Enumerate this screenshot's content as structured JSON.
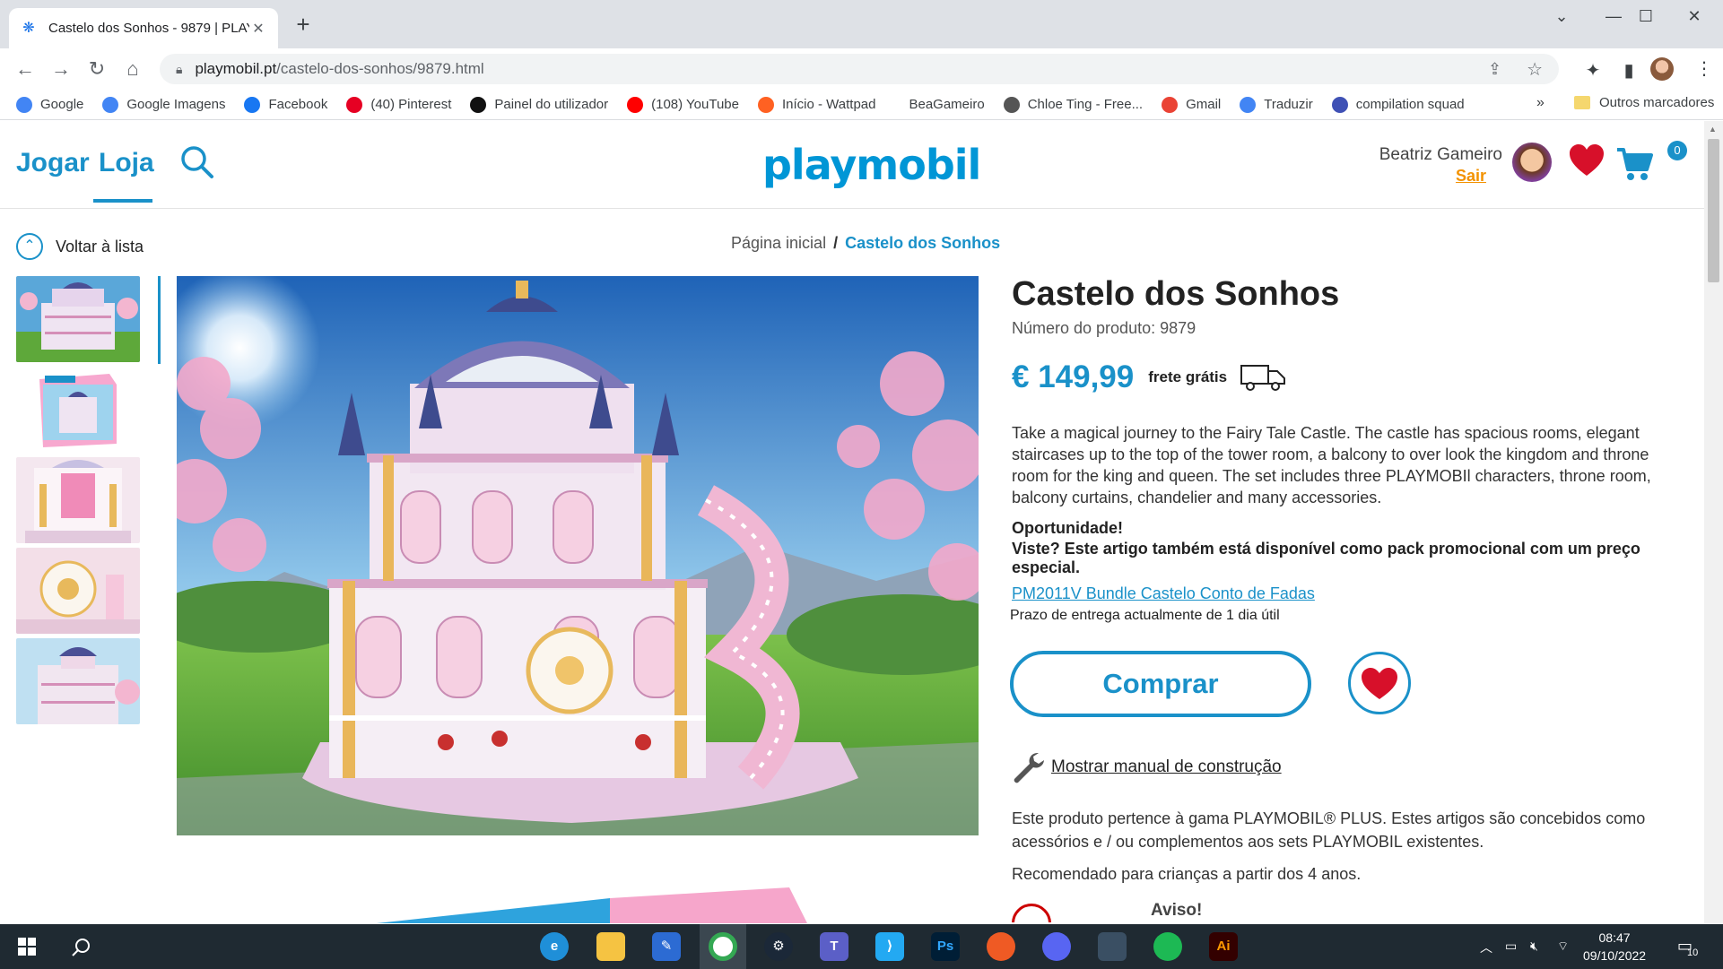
{
  "browser": {
    "tab_title": "Castelo dos Sonhos - 9879 | PLAY",
    "tab_close": "✕",
    "new_tab": "+",
    "url_host": "playmobil.pt",
    "url_path": "/castelo-dos-sonhos/9879.html",
    "window_controls": [
      "⌄",
      "—",
      "☐",
      "✕"
    ],
    "bookmarks": [
      {
        "label": "Google",
        "icon": "google-icon",
        "color": "#4285f4"
      },
      {
        "label": "Google Imagens",
        "icon": "google-icon",
        "color": "#4285f4"
      },
      {
        "label": "Facebook",
        "icon": "facebook-icon",
        "color": "#1877f2"
      },
      {
        "label": "(40) Pinterest",
        "icon": "pinterest-icon",
        "color": "#e60023"
      },
      {
        "label": "Painel do utilizador",
        "icon": "dashboard-icon",
        "color": "#111111"
      },
      {
        "label": "(108) YouTube",
        "icon": "youtube-icon",
        "color": "#ff0000"
      },
      {
        "label": "Início - Wattpad",
        "icon": "wattpad-icon",
        "color": "#ff6122"
      },
      {
        "label": "BeaGameiro",
        "icon": "",
        "color": ""
      },
      {
        "label": "Chloe Ting - Free...",
        "icon": "chloe-icon",
        "color": "#555555"
      },
      {
        "label": "Gmail",
        "icon": "gmail-icon",
        "color": "#ea4335"
      },
      {
        "label": "Traduzir",
        "icon": "translate-icon",
        "color": "#4285f4"
      },
      {
        "label": "compilation squad",
        "icon": "forms-icon",
        "color": "#3f51b5"
      }
    ],
    "bookmarks_more": "»",
    "other_bookmarks": "Outros marcadores"
  },
  "header": {
    "nav": [
      "Jogar",
      "Loja"
    ],
    "logo": "playmobil",
    "user_name": "Beatriz Gameiro",
    "logout": "Sair",
    "cart_count": "0"
  },
  "page": {
    "back_label": "Voltar à lista",
    "breadcrumb_home": "Página inicial",
    "breadcrumb_sep": "/",
    "breadcrumb_current": "Castelo dos Sonhos"
  },
  "product": {
    "title": "Castelo dos Sonhos",
    "number": "Número do produto: 9879",
    "price": "€ 149,99",
    "free_shipping": "frete grátis",
    "description": "Take a magical journey to the Fairy Tale Castle. The castle has spacious rooms, elegant staircases up to the top of the tower room, a balcony to over look the kingdom and throne room for the king and queen. The set includes three PLAYMOBIl characters, throne room, balcony curtains, chandelier and many accessories.",
    "opportunity_title": "Oportunidade!",
    "opportunity_text": "Viste? Este artigo também está disponível como pack promocional com um preço especial.",
    "bundle_link": "PM2011V Bundle Castelo Conto de Fadas",
    "delivery": "Prazo de entrega actualmente de 1 dia útil",
    "buy_label": "Comprar",
    "manual_label": "Mostrar manual de construção",
    "plus_note": "Este produto pertence à gama PLAYMOBIL® PLUS. Estes artigos são concebidos como acessórios e / ou complementos aos sets PLAYMOBIL existentes.",
    "age_note": "Recomendado para crianças a partir dos 4 anos.",
    "warning_title": "Aviso!"
  },
  "taskbar": {
    "time": "08:47",
    "date": "09/10/2022",
    "notifications": "10",
    "apps": [
      "edge",
      "file-explorer",
      "pen",
      "chrome",
      "steam",
      "teams",
      "vscode",
      "photoshop",
      "bitdefender",
      "discord",
      "sql",
      "spotify",
      "illustrator"
    ]
  },
  "colors": {
    "brand_blue": "#1a91c9",
    "accent_orange": "#f39200",
    "heart_red": "#d7102a"
  }
}
